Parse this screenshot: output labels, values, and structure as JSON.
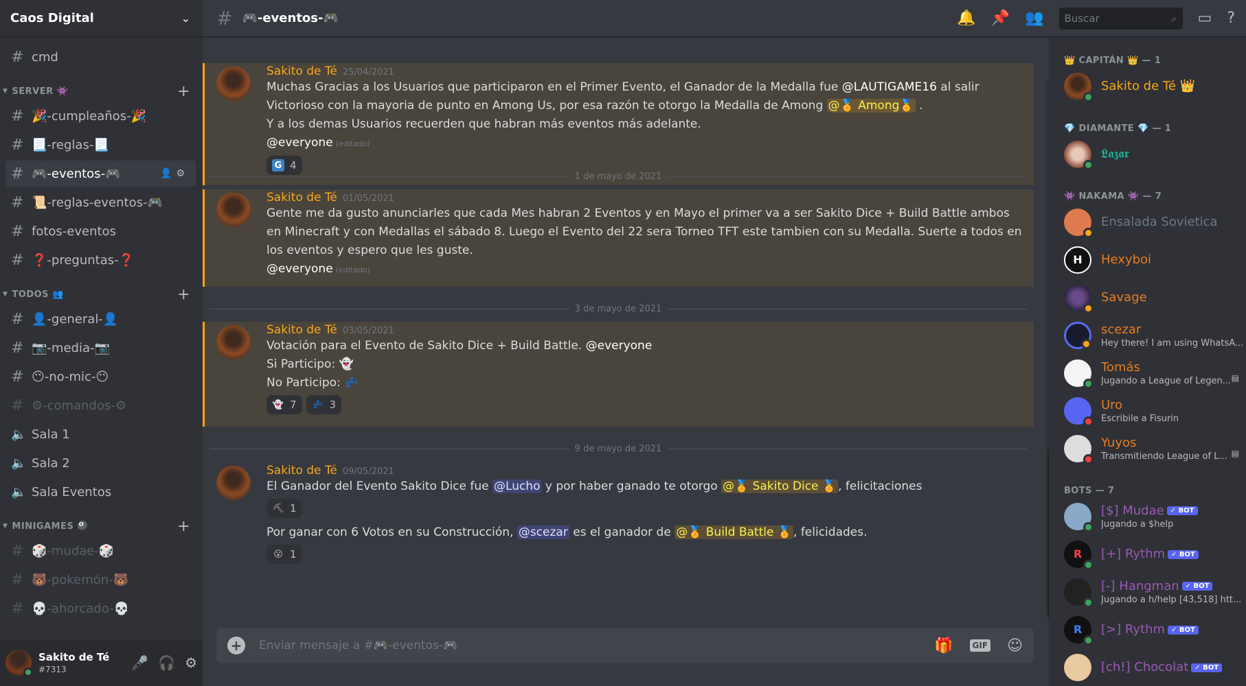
{
  "server": {
    "name": "Caos Digital"
  },
  "channels_top": [
    {
      "name": "cmd"
    }
  ],
  "categories": {
    "server": {
      "label": "SERVER 👾"
    },
    "todos": {
      "label": "TODOS 👥"
    },
    "minigames": {
      "label": "MINIGAMES 🎱"
    }
  },
  "server_channels": [
    {
      "name": "🎉-cumpleaños-🎉"
    },
    {
      "name": "📃-reglas-📃"
    },
    {
      "name": "🎮-eventos-🎮"
    },
    {
      "name": "📜-reglas-eventos-🎮"
    },
    {
      "name": "fotos-eventos"
    },
    {
      "name": "❓-preguntas-❓"
    }
  ],
  "todos_channels": [
    {
      "name": "👤-general-👤"
    },
    {
      "name": "📷-media-📷"
    },
    {
      "name": "😶-no-mic-😶"
    },
    {
      "name": "⚙-comandos-⚙"
    }
  ],
  "voice_channels": [
    {
      "name": "Sala 1"
    },
    {
      "name": "Sala 2"
    },
    {
      "name": "Sala Eventos"
    }
  ],
  "minigame_channels": [
    {
      "name": "🎲-mudae-🎲"
    },
    {
      "name": "🐻-pokemón-🐻"
    },
    {
      "name": "💀-ahorcado-💀"
    }
  ],
  "user": {
    "name": "Sakito de Té",
    "tag": "#7313"
  },
  "header": {
    "channel": "🎮-eventos-🎮",
    "search_placeholder": "Buscar"
  },
  "messages": [
    {
      "author": "Sakito de Té",
      "date": "25/04/2021",
      "line1a": "Muchas Gracias a los Usuarios que participaron en el Primer Evento, el Ganador de la Medalla fue ",
      "mention1": "@LAUTIGAME16",
      "line1b": " al salir Victorioso con la mayoria de punto en Among Us, por esa razón te otorgo la Medalla de Among ",
      "role1": "@🏅 Among🏅",
      "line1c": " .",
      "line2": "Y a los demas Usuarios recuerden que habran más eventos más adelante.",
      "everyone": "@everyone",
      "edited": "(editado)",
      "reaction_emoji": "G",
      "reaction_count": "4"
    },
    {
      "author": "Sakito de Té",
      "date": "01/05/2021",
      "text": "Gente me da gusto anunciarles que cada Mes habran 2 Eventos y en Mayo el primer va a ser Sakito Dice + Build Battle ambos en Minecraft y con Medallas el sábado 8. Luego el Evento del 22 sera Torneo TFT este tambien con su Medalla.  Suerte a todos en los eventos y espero que les guste.",
      "everyone": "@everyone",
      "edited": "(editado)"
    },
    {
      "author": "Sakito de Té",
      "date": "03/05/2021",
      "line1": "Votación para el Evento de Sakito Dice + Build Battle. ",
      "everyone": "@everyone",
      "line2": "Si Participo: ",
      "line3": "No Participo: ",
      "r1": "7",
      "r2": "3"
    },
    {
      "author": "Sakito de Té",
      "date": "09/05/2021",
      "p1a": "El Ganador del Evento Sakito Dice fue ",
      "p1m": "@Lucho",
      "p1b": " y por haber ganado te otorgo ",
      "p1r": "@🏅 Sakito Dice 🏅",
      "p1c": ", felicitaciones",
      "r1": "1",
      "p2a": "Por ganar con 6 Votos en su Construcción, ",
      "p2m": "@scezar",
      "p2b": "  es el ganador de ",
      "p2r": "@🏅 Build Battle 🏅",
      "p2c": ", felicidades.",
      "r2": "1"
    }
  ],
  "dividers": [
    "1 de mayo de 2021",
    "3 de mayo de 2021",
    "9 de mayo de 2021"
  ],
  "composer": {
    "placeholder": "Enviar mensaje a #🎮-eventos-🎮"
  },
  "member_groups": {
    "capitan": "👑 CAPITÁN 👑 — 1",
    "diamante": "💎 DIAMANTE 💎 — 1",
    "nakama": "👾 NAKAMA 👾 — 7",
    "bots": "BOTS — 7"
  },
  "members": [
    {
      "name": "Sakito de Té 👑",
      "status": "",
      "color": "#faa61a"
    },
    {
      "name": "𝕷𝖆𝖟𝖆𝖗",
      "status": "",
      "color": "#1abc9c"
    },
    {
      "name": "Ensalada Sovietica",
      "status": "",
      "color": "#6b7a86"
    },
    {
      "name": "Hexyboi",
      "status": "",
      "color": "#e67e22"
    },
    {
      "name": "Savage",
      "status": "",
      "color": "#e67e22"
    },
    {
      "name": "scezar",
      "status": "Hey there! I am using WhatsA...",
      "color": "#e67e22"
    },
    {
      "name": "Tomás",
      "status": "Jugando a League of Legen...",
      "color": "#e67e22"
    },
    {
      "name": "Uro",
      "status": "Escribile a Fisurin",
      "color": "#e67e22"
    },
    {
      "name": "Yuyos",
      "status": "Transmitiendo League of L...",
      "color": "#e67e22"
    }
  ],
  "bots": [
    {
      "name": "[$] Mudae",
      "status": "Jugando a $help",
      "badge": "✓ BOT"
    },
    {
      "name": "[+] Rythm",
      "status": "",
      "badge": "✓ BOT"
    },
    {
      "name": "[-] Hangman",
      "status": "Jugando a h/help [43,518] htt...",
      "badge": "✓ BOT"
    },
    {
      "name": "[>] Rythm",
      "status": "",
      "badge": "✓ BOT"
    },
    {
      "name": "[ch!] Chocolat",
      "status": "",
      "badge": "✓ BOT"
    }
  ]
}
